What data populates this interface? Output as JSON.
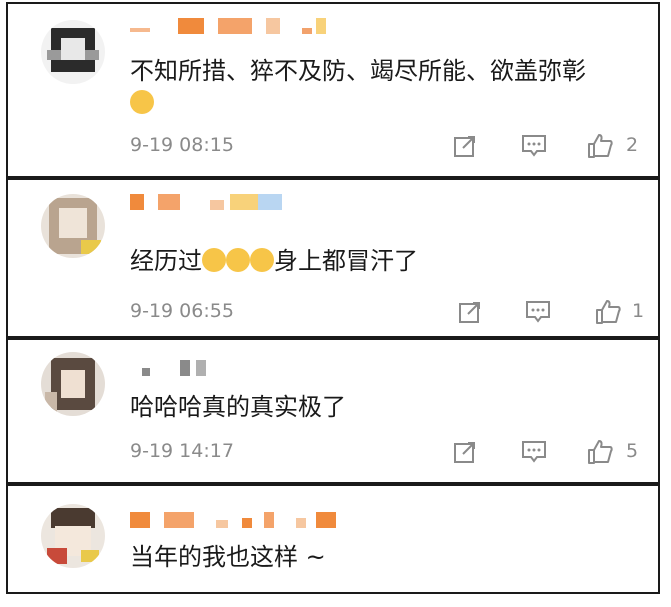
{
  "comments": [
    {
      "text": "不知所措、猝不及防、竭尽所能、欲盖弥彰",
      "emoji_icon": "laughing-face-icon",
      "time": "9-19 08:15",
      "likes": "2"
    },
    {
      "text_before": "经历过",
      "emoji_icons": [
        "smiling-face-icon",
        "screaming-face-icon",
        "screaming-face-icon"
      ],
      "text_after": "身上都冒汗了",
      "time": "9-19 06:55",
      "likes": "1"
    },
    {
      "text": "哈哈哈真的真实极了",
      "time": "9-19 14:17",
      "likes": "5"
    },
    {
      "text": "当年的我也这样 ~"
    }
  ],
  "icons": {
    "share": "share-icon",
    "comment": "comment-icon",
    "like": "thumbs-up-icon"
  },
  "colors": {
    "text": "#1a1a1a",
    "meta": "#8a8a8a",
    "name_blur": "#f08a3c"
  }
}
